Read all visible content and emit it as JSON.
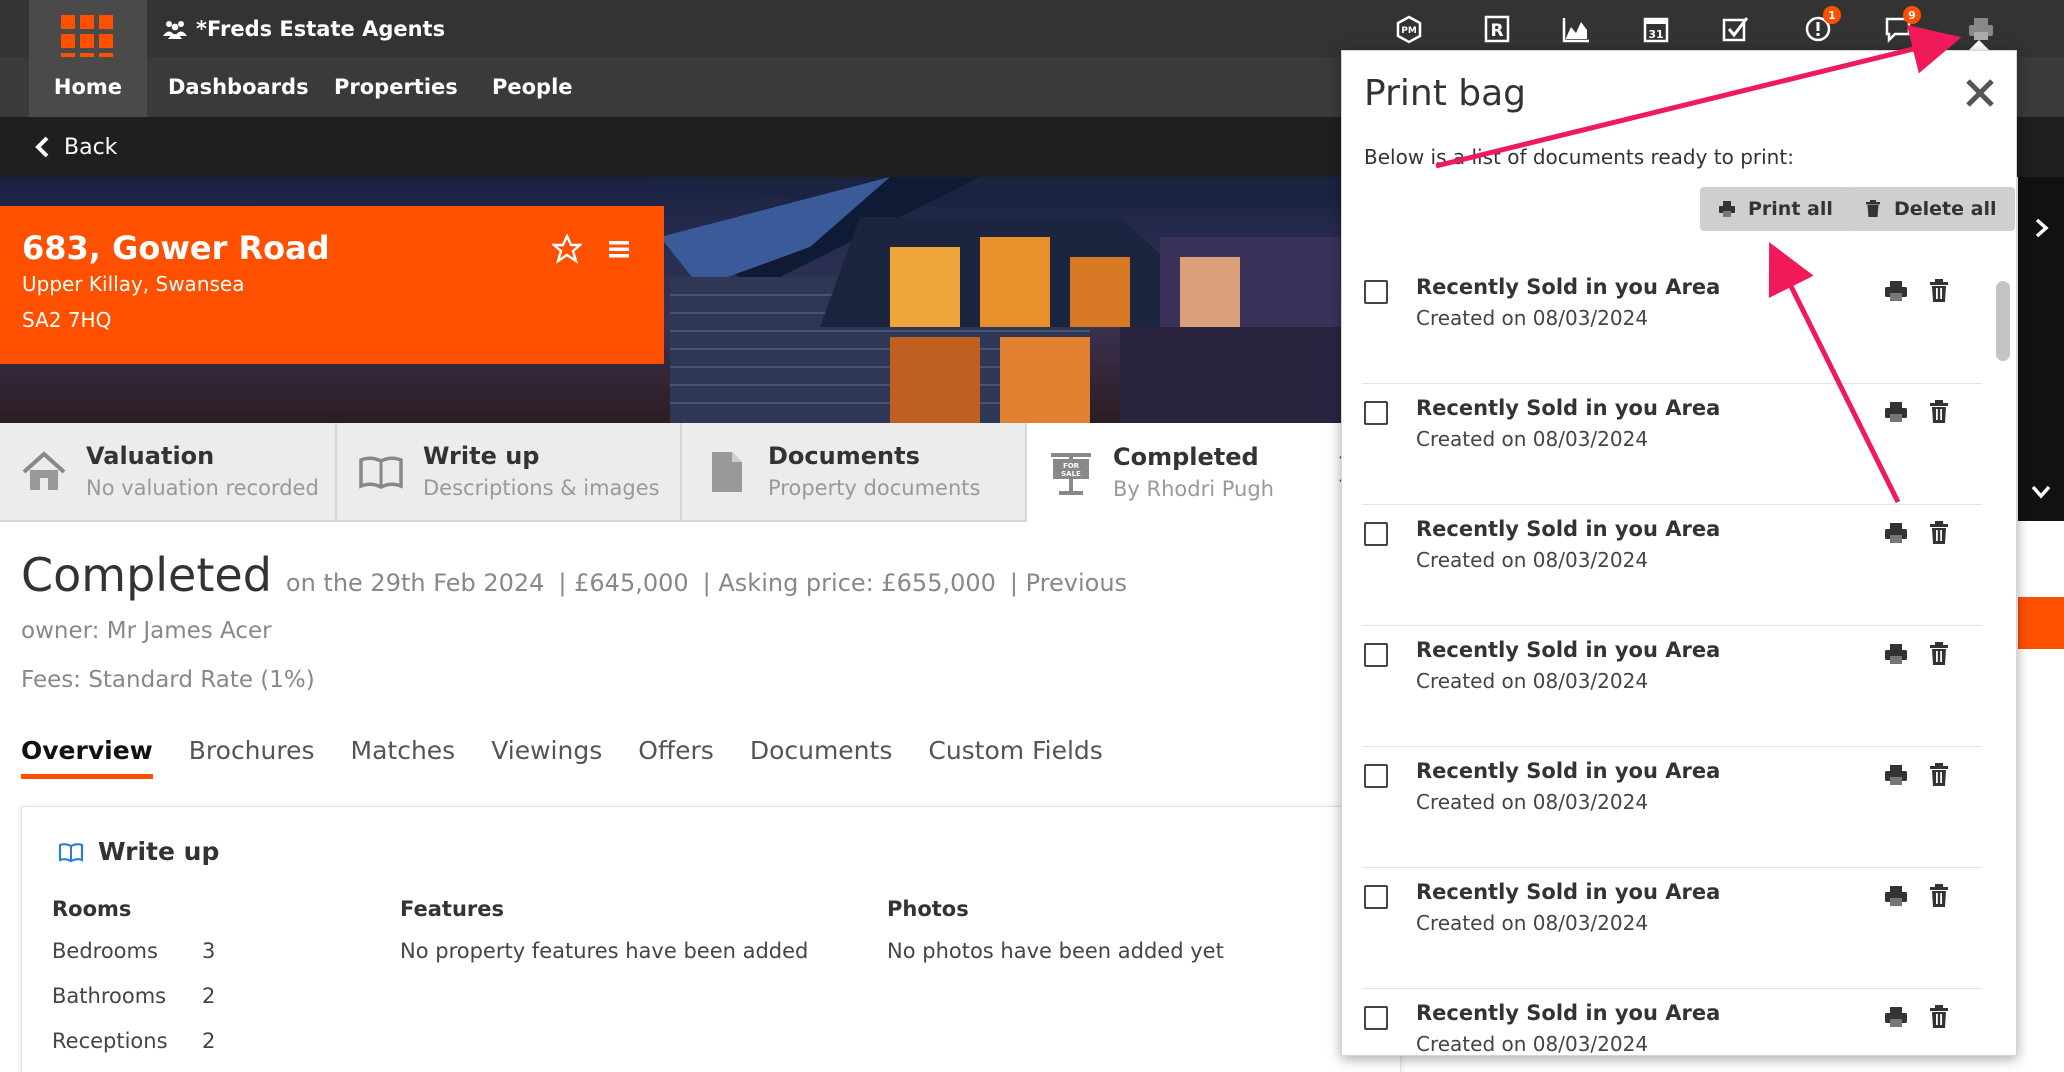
{
  "topbar": {
    "agency_name": "*Freds Estate Agents",
    "icons": [
      {
        "name": "property-manager-icon",
        "badge": ""
      },
      {
        "name": "rightmove-icon",
        "badge": ""
      },
      {
        "name": "chart-icon",
        "badge": ""
      },
      {
        "name": "calendar-icon",
        "badge": ""
      },
      {
        "name": "tasks-icon",
        "badge": ""
      },
      {
        "name": "alerts-icon",
        "badge": "1"
      },
      {
        "name": "messages-icon",
        "badge": "9"
      },
      {
        "name": "print-icon",
        "badge": ""
      }
    ]
  },
  "nav": {
    "home": "Home",
    "dashboards": "Dashboards",
    "properties": "Properties",
    "people": "People"
  },
  "back": {
    "label": "Back"
  },
  "address": {
    "line1": "683, Gower Road",
    "line2": "Upper Killay, Swansea",
    "line3": "SA2 7HQ"
  },
  "status_tabs": [
    {
      "title": "Valuation",
      "subtitle": "No valuation recorded"
    },
    {
      "title": "Write up",
      "subtitle": "Descriptions & images"
    },
    {
      "title": "Documents",
      "subtitle": "Property documents"
    },
    {
      "title": "Completed",
      "subtitle": "By Rhodri Pugh"
    }
  ],
  "headline": {
    "status": "Completed",
    "date": "on the 29th Feb 2024",
    "sold": "| £645,000",
    "asking": "| Asking price: £655,000",
    "previous": "| Previous"
  },
  "owner": "owner: Mr James Acer",
  "fees": "Fees: Standard Rate (1%)",
  "sub_tabs": [
    "Overview",
    "Brochures",
    "Matches",
    "Viewings",
    "Offers",
    "Documents",
    "Custom Fields"
  ],
  "writeup": {
    "title": "Write up",
    "rooms_heading": "Rooms",
    "features_heading": "Features",
    "photos_heading": "Photos",
    "features_text": "No property features have been added",
    "photos_text": "No photos have been added yet",
    "rooms": [
      {
        "label": "Bedrooms",
        "count": "3"
      },
      {
        "label": "Bathrooms",
        "count": "2"
      },
      {
        "label": "Receptions",
        "count": "2"
      }
    ]
  },
  "printbag": {
    "title": "Print bag",
    "description": "Below is a list of documents ready to print:",
    "print_all": "Print all",
    "delete_all": "Delete all",
    "items": [
      {
        "name": "Recently Sold in you Area",
        "created": "Created on 08/03/2024"
      },
      {
        "name": "Recently Sold in you Area",
        "created": "Created on 08/03/2024"
      },
      {
        "name": "Recently Sold in you Area",
        "created": "Created on 08/03/2024"
      },
      {
        "name": "Recently Sold in you Area",
        "created": "Created on 08/03/2024"
      },
      {
        "name": "Recently Sold in you Area",
        "created": "Created on 08/03/2024"
      },
      {
        "name": "Recently Sold in you Area",
        "created": "Created on 08/03/2024"
      },
      {
        "name": "Recently Sold in you Area",
        "created": "Created on 08/03/2024"
      }
    ]
  },
  "colors": {
    "brand": "#ff5000",
    "topbar": "#333333",
    "nav": "#3a3a3a",
    "annotation_arrow": "#f0195a"
  }
}
